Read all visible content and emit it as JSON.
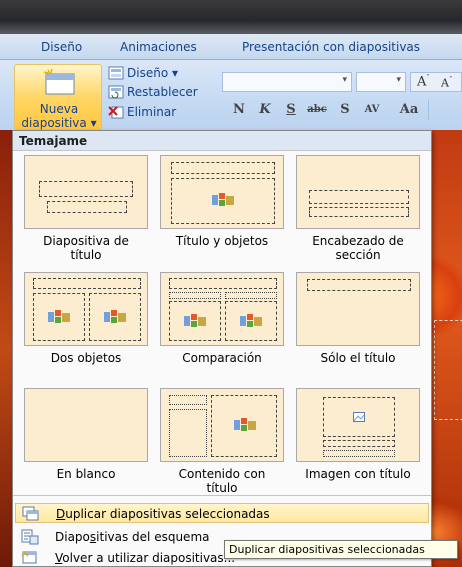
{
  "ribbon_tabs": [
    "Diseño",
    "Animaciones",
    "Presentación con diapositivas"
  ],
  "ribbon": {
    "new_slide_line1": "Nueva",
    "new_slide_line2": "diapositiva ▾",
    "layout_label": "Diseño ▾",
    "reset_label": "Restablecer",
    "delete_label": "Eliminar",
    "format_buttons": [
      "N",
      "K",
      "S",
      "abc",
      "S",
      "AV",
      "Aa"
    ]
  },
  "gallery": {
    "header": "Temajame",
    "layouts": [
      {
        "line1": "Diapositiva de",
        "line2": "título"
      },
      {
        "line1": "Título y objetos",
        "line2": ""
      },
      {
        "line1": "Encabezado de",
        "line2": "sección"
      },
      {
        "line1": "Dos objetos",
        "line2": ""
      },
      {
        "line1": "Comparación",
        "line2": ""
      },
      {
        "line1": "Sólo el título",
        "line2": ""
      },
      {
        "line1": "En blanco",
        "line2": ""
      },
      {
        "line1": "Contenido con",
        "line2": "título"
      },
      {
        "line1": "Imagen con título",
        "line2": ""
      }
    ]
  },
  "menu": {
    "duplicate_first": "D",
    "duplicate_rest": "uplicar diapositivas seleccionadas",
    "outline_pre": "Diapo",
    "outline_u": "s",
    "outline_post": "itivas del esquema",
    "reuse_first": "V",
    "reuse_rest": "olver a utilizar diapositivas..."
  },
  "tooltip": "Duplicar diapositivas seleccionadas",
  "colors": {
    "hover_bg": "#ffe7a0",
    "thumb_bg": "#fcecd0",
    "ribbon_text": "#15428b"
  }
}
